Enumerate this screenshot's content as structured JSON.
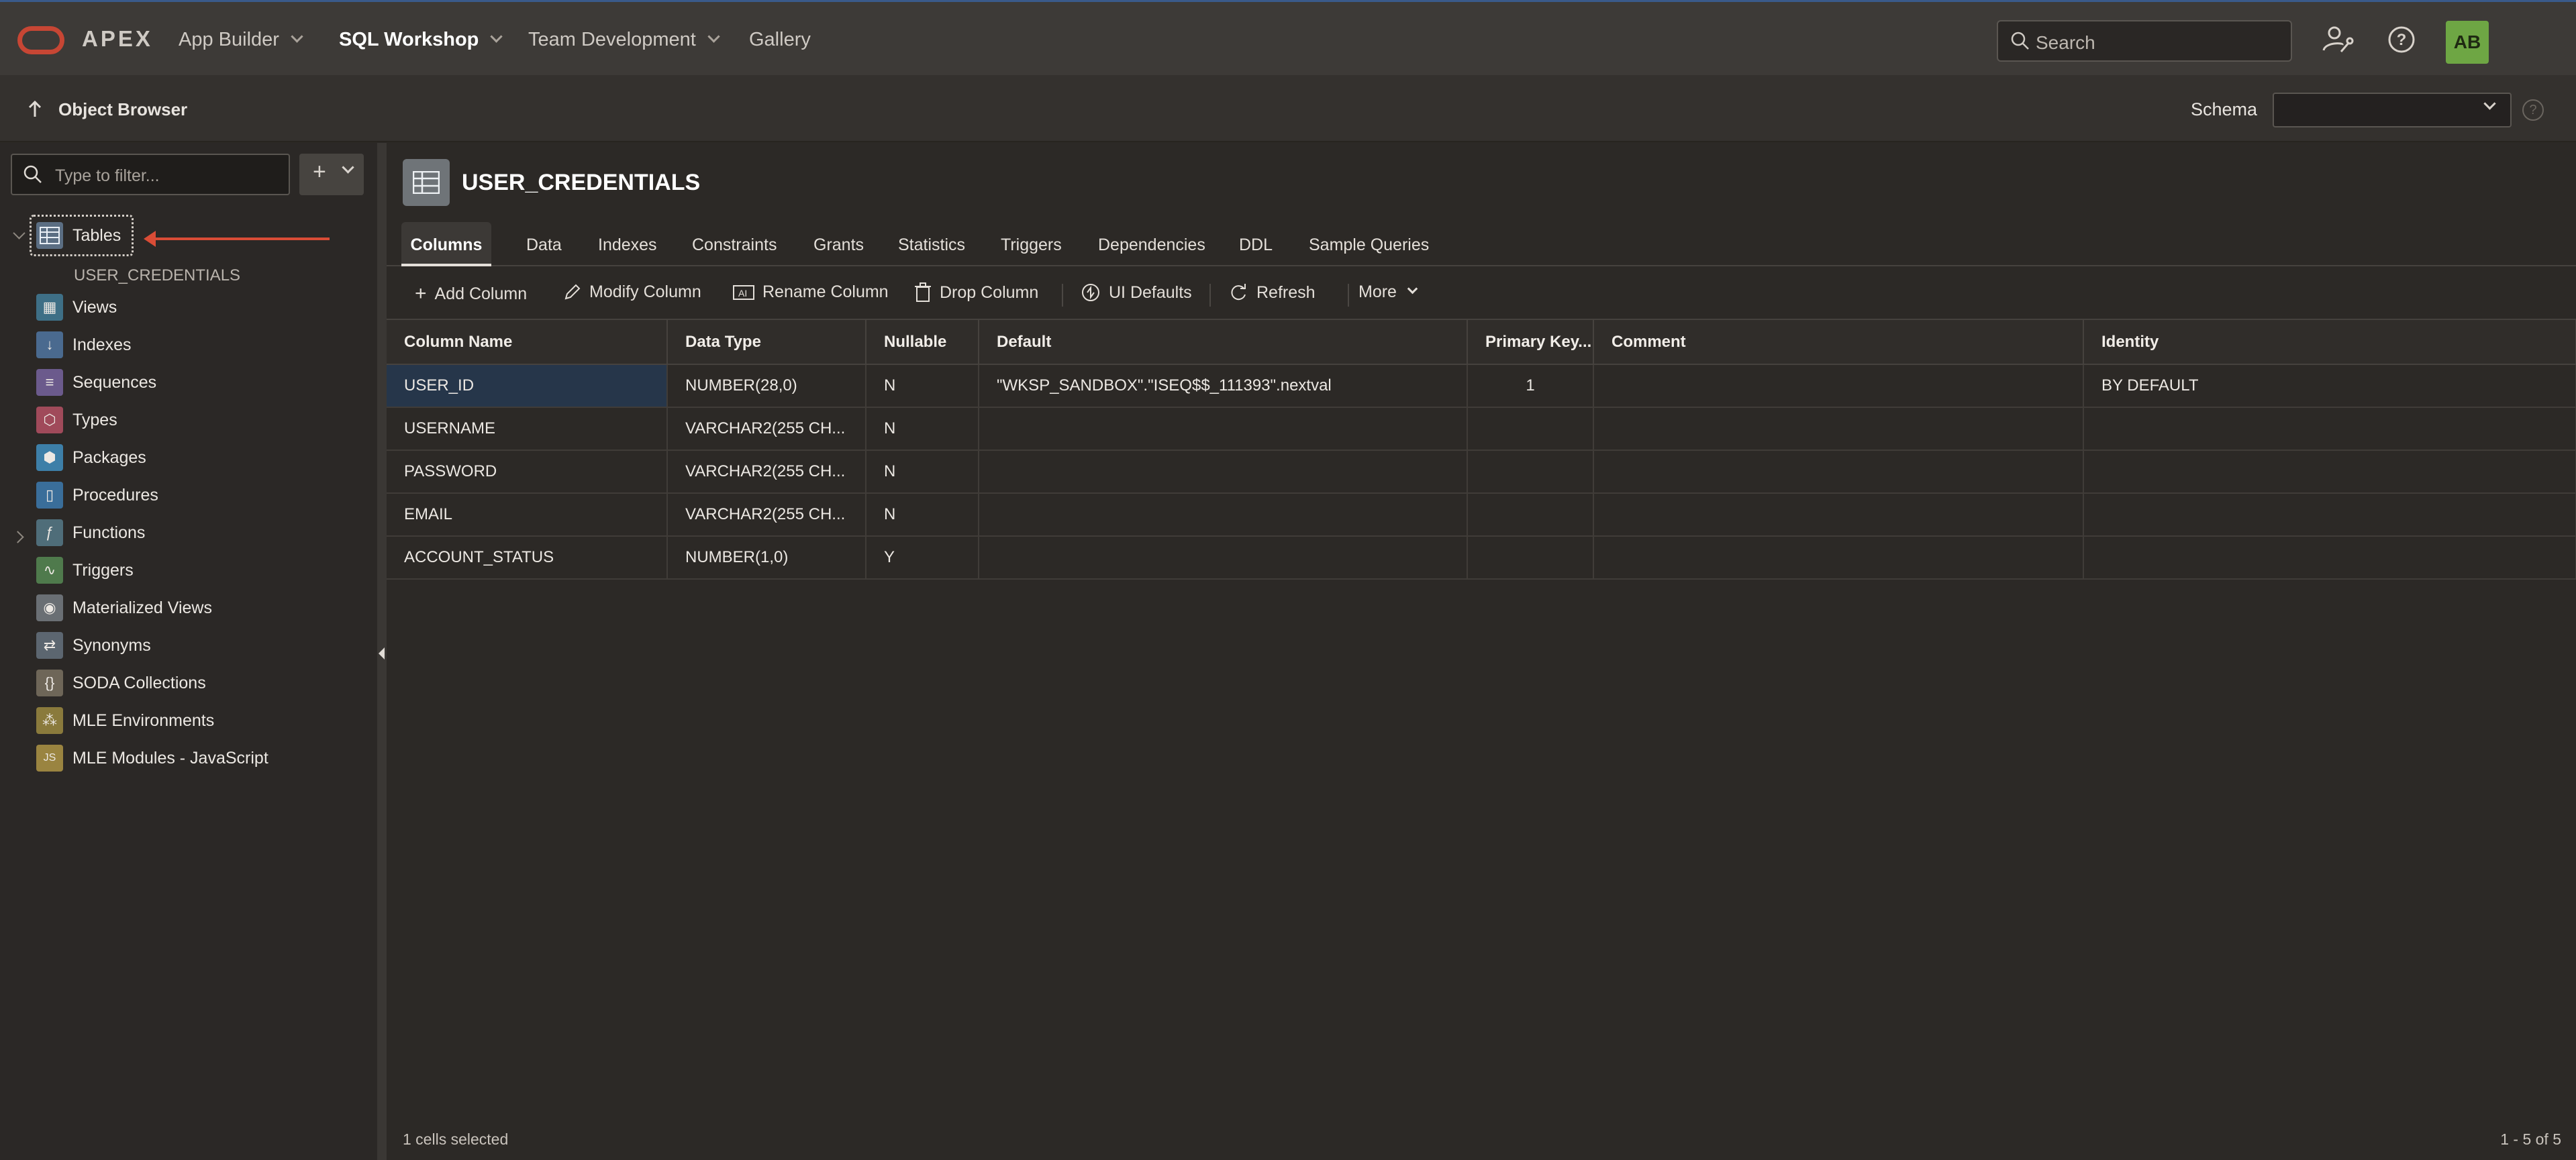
{
  "app": {
    "brand": "APEX",
    "avatar_initials": "AB"
  },
  "nav": [
    {
      "label": "App Builder",
      "has_menu": true
    },
    {
      "label": "SQL Workshop",
      "has_menu": true,
      "active": true
    },
    {
      "label": "Team Development",
      "has_menu": true
    },
    {
      "label": "Gallery",
      "has_menu": false
    }
  ],
  "search": {
    "placeholder": "Search"
  },
  "breadcrumb": {
    "title": "Object Browser"
  },
  "schema": {
    "label": "Schema",
    "value": ""
  },
  "sidebar": {
    "filter_placeholder": "Type to filter...",
    "items": [
      {
        "label": "Tables",
        "icon": "table-icon",
        "expanded": true,
        "children": [
          "USER_CREDENTIALS"
        ]
      },
      {
        "label": "Views",
        "icon": "views-icon"
      },
      {
        "label": "Indexes",
        "icon": "indexes-icon"
      },
      {
        "label": "Sequences",
        "icon": "sequences-icon"
      },
      {
        "label": "Types",
        "icon": "types-icon"
      },
      {
        "label": "Packages",
        "icon": "packages-icon"
      },
      {
        "label": "Procedures",
        "icon": "procedures-icon"
      },
      {
        "label": "Functions",
        "icon": "functions-icon",
        "collapsed": true
      },
      {
        "label": "Triggers",
        "icon": "triggers-icon"
      },
      {
        "label": "Materialized Views",
        "icon": "materialized-views-icon"
      },
      {
        "label": "Synonyms",
        "icon": "synonyms-icon"
      },
      {
        "label": "SODA Collections",
        "icon": "soda-collections-icon"
      },
      {
        "label": "MLE Environments",
        "icon": "mle-environments-icon"
      },
      {
        "label": "MLE Modules - JavaScript",
        "icon": "mle-modules-icon"
      }
    ]
  },
  "object": {
    "title": "USER_CREDENTIALS"
  },
  "tabs": [
    "Columns",
    "Data",
    "Indexes",
    "Constraints",
    "Grants",
    "Statistics",
    "Triggers",
    "Dependencies",
    "DDL",
    "Sample Queries"
  ],
  "toolbar": {
    "add_column": "Add Column",
    "modify_column": "Modify Column",
    "rename_column": "Rename Column",
    "drop_column": "Drop Column",
    "ui_defaults": "UI Defaults",
    "refresh": "Refresh",
    "more": "More"
  },
  "grid": {
    "headers": [
      "Column Name",
      "Data Type",
      "Nullable",
      "Default",
      "Primary Key...",
      "Comment",
      "Identity"
    ],
    "rows": [
      [
        "USER_ID",
        "NUMBER(28,0)",
        "N",
        "\"WKSP_SANDBOX\".\"ISEQ$$_111393\".nextval",
        "1",
        "",
        "BY DEFAULT"
      ],
      [
        "USERNAME",
        "VARCHAR2(255 CH...",
        "N",
        "",
        "",
        "",
        ""
      ],
      [
        "PASSWORD",
        "VARCHAR2(255 CH...",
        "N",
        "",
        "",
        "",
        ""
      ],
      [
        "EMAIL",
        "VARCHAR2(255 CH...",
        "N",
        "",
        "",
        "",
        ""
      ],
      [
        "ACCOUNT_STATUS",
        "NUMBER(1,0)",
        "Y",
        "",
        "",
        "",
        ""
      ]
    ]
  },
  "footer": {
    "selection": "1 cells selected",
    "pagination": "1 - 5 of 5"
  },
  "colors": {
    "accent_oracle": "#c74634",
    "avatar": "#6ea644",
    "annotation_arrow": "#d94c36",
    "selected_cell": "#26364a"
  }
}
